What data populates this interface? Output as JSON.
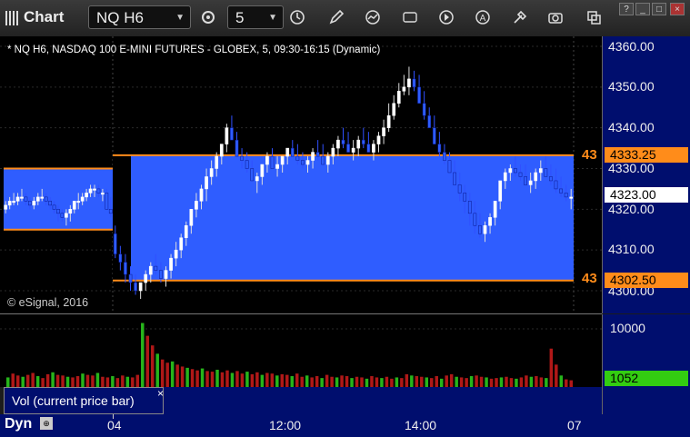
{
  "app": {
    "title": "Chart"
  },
  "toolbar": {
    "symbol": "NQ H6",
    "interval": "5",
    "icons": [
      "refresh-icon",
      "clock-icon",
      "pencil-icon",
      "studies-icon",
      "quote-icon",
      "play-icon",
      "a-icon",
      "tools-icon",
      "camera-icon",
      "copy-icon"
    ],
    "quote_icon_text": "QUOTE"
  },
  "chart": {
    "description": "* NQ H6, NASDAQ 100 E-MINI FUTURES - GLOBEX, 5, 09:30-16:15 (Dynamic)",
    "copyright": "© eSignal, 2016",
    "price_labels": [
      "4360.00",
      "4350.00",
      "4340.00",
      "4330.00",
      "4320.00",
      "4310.00",
      "4300.00"
    ],
    "upper_level_tag": "4333.25",
    "lower_level_tag": "4302.50",
    "current_price_tag": "4323.00",
    "upper_level_partial": "43",
    "lower_level_partial": "43",
    "colors": {
      "band": "#2f5dff",
      "level_line": "#ff8c1a",
      "axis_bg": "#000e6e",
      "up": "#ffffff",
      "down": "#2f5dff"
    }
  },
  "volume": {
    "label": "Vol (current price bar)",
    "close_label": "×",
    "axis_label": "10000",
    "current_value": "1052"
  },
  "time_axis": {
    "labels": [
      "04",
      "12:00",
      "14:00",
      "07"
    ]
  },
  "footer": {
    "mode": "Dyn"
  },
  "chart_data": {
    "type": "candlestick",
    "title": "",
    "ylim": [
      4298,
      4365
    ],
    "yticks": [
      4300,
      4310,
      4320,
      4330,
      4340,
      4350,
      4360
    ],
    "levels": [
      4333.25,
      4302.5
    ],
    "current_price": 4323.0,
    "series": [
      {
        "o": [
          4320,
          4321,
          4322,
          4322,
          4323,
          4323,
          4322,
          4321,
          4322,
          4323,
          4323,
          4322,
          4321,
          4320,
          4319,
          4318,
          4319,
          4320,
          4322,
          4322,
          4323,
          4324,
          4325,
          4325,
          4324,
          4324,
          4320
        ],
        "h": [
          4322,
          4323,
          4324,
          4324,
          4325,
          4324,
          4323,
          4323,
          4324,
          4325,
          4324,
          4323,
          4322,
          4321,
          4320,
          4320,
          4321,
          4322,
          4324,
          4324,
          4325,
          4326,
          4326,
          4326,
          4325,
          4325,
          4323
        ],
        "l": [
          4319,
          4320,
          4321,
          4321,
          4322,
          4321,
          4320,
          4320,
          4321,
          4322,
          4321,
          4320,
          4319,
          4317,
          4317,
          4316,
          4317,
          4319,
          4320,
          4321,
          4322,
          4323,
          4323,
          4323,
          4322,
          4320,
          4318
        ],
        "c": [
          4321,
          4322,
          4322,
          4323,
          4323,
          4322,
          4321,
          4322,
          4323,
          4323,
          4322,
          4321,
          4320,
          4319,
          4318,
          4319,
          4320,
          4322,
          4322,
          4323,
          4324,
          4325,
          4325,
          4324,
          4324,
          4320,
          4319
        ]
      },
      {
        "o": [
          4314,
          4309,
          4307,
          4304,
          4302,
          4300,
          4302,
          4304,
          4306,
          4305,
          4303,
          4305,
          4308,
          4310,
          4313,
          4316,
          4320,
          4322,
          4325,
          4328,
          4330,
          4333,
          4336,
          4340,
          4337,
          4333,
          4332,
          4330,
          4327,
          4328,
          4331,
          4333,
          4330,
          4331,
          4333,
          4335,
          4333,
          4332,
          4331,
          4332,
          4334,
          4333,
          4331,
          4333,
          4335,
          4337,
          4336,
          4334,
          4335,
          4337,
          4336,
          4334,
          4336,
          4338,
          4340,
          4343,
          4346,
          4349,
          4350,
          4352,
          4350,
          4346,
          4343,
          4340,
          4336,
          4334,
          4332,
          4329,
          4326,
          4324,
          4322,
          4319,
          4316,
          4314,
          4316,
          4318,
          4322,
          4327,
          4329,
          4330,
          4329,
          4328,
          4326,
          4327,
          4329,
          4330,
          4328,
          4327,
          4325,
          4324,
          4323
        ],
        "h": [
          4316,
          4311,
          4309,
          4306,
          4304,
          4302,
          4305,
          4307,
          4309,
          4307,
          4306,
          4309,
          4312,
          4314,
          4317,
          4320,
          4324,
          4326,
          4330,
          4332,
          4334,
          4336,
          4341,
          4343,
          4339,
          4335,
          4334,
          4332,
          4329,
          4331,
          4334,
          4335,
          4333,
          4333,
          4335,
          4337,
          4336,
          4334,
          4333,
          4335,
          4337,
          4336,
          4334,
          4336,
          4338,
          4340,
          4339,
          4337,
          4338,
          4340,
          4339,
          4337,
          4339,
          4342,
          4346,
          4348,
          4351,
          4353,
          4355,
          4354,
          4353,
          4349,
          4345,
          4343,
          4339,
          4336,
          4334,
          4332,
          4329,
          4326,
          4324,
          4322,
          4319,
          4317,
          4319,
          4322,
          4327,
          4330,
          4331,
          4333,
          4331,
          4331,
          4329,
          4330,
          4332,
          4333,
          4331,
          4330,
          4328,
          4326,
          4325
        ],
        "l": [
          4308,
          4305,
          4302,
          4300,
          4299,
          4298,
          4300,
          4302,
          4304,
          4302,
          4301,
          4303,
          4306,
          4308,
          4311,
          4314,
          4318,
          4320,
          4322,
          4326,
          4328,
          4331,
          4334,
          4337,
          4333,
          4330,
          4329,
          4327,
          4324,
          4326,
          4329,
          4331,
          4328,
          4329,
          4331,
          4333,
          4331,
          4330,
          4329,
          4330,
          4332,
          4331,
          4329,
          4331,
          4333,
          4335,
          4334,
          4332,
          4333,
          4335,
          4334,
          4332,
          4334,
          4336,
          4339,
          4342,
          4345,
          4348,
          4348,
          4349,
          4346,
          4342,
          4340,
          4336,
          4333,
          4331,
          4329,
          4326,
          4322,
          4319,
          4316,
          4314,
          4313,
          4312,
          4314,
          4316,
          4320,
          4325,
          4327,
          4328,
          4327,
          4326,
          4324,
          4325,
          4327,
          4328,
          4326,
          4324,
          4323,
          4322,
          4320
        ],
        "c": [
          4309,
          4307,
          4304,
          4302,
          4300,
          4302,
          4304,
          4306,
          4305,
          4303,
          4305,
          4308,
          4310,
          4313,
          4316,
          4320,
          4322,
          4325,
          4328,
          4330,
          4333,
          4336,
          4340,
          4337,
          4333,
          4332,
          4330,
          4327,
          4328,
          4331,
          4333,
          4330,
          4331,
          4333,
          4335,
          4333,
          4332,
          4331,
          4332,
          4334,
          4333,
          4331,
          4333,
          4335,
          4337,
          4336,
          4334,
          4335,
          4337,
          4336,
          4334,
          4336,
          4338,
          4340,
          4343,
          4346,
          4349,
          4350,
          4352,
          4350,
          4346,
          4343,
          4340,
          4336,
          4334,
          4332,
          4329,
          4326,
          4324,
          4322,
          4319,
          4316,
          4314,
          4316,
          4318,
          4322,
          4327,
          4329,
          4330,
          4329,
          4328,
          4326,
          4327,
          4329,
          4330,
          4328,
          4327,
          4325,
          4324,
          4323,
          4323
        ]
      }
    ],
    "volume": [
      1500,
      2100,
      1800,
      1600,
      1900,
      2200,
      1700,
      1400,
      2000,
      2300,
      1900,
      1800,
      1600,
      1500,
      1700,
      2100,
      1900,
      1800,
      2200,
      1600,
      1500,
      1700,
      1400,
      1800,
      1600,
      1500,
      1900,
      10000,
      8000,
      6500,
      5200,
      4300,
      3800,
      4000,
      3500,
      3200,
      3000,
      2800,
      2600,
      2900,
      2500,
      2400,
      2700,
      2300,
      2600,
      2200,
      2500,
      2100,
      2400,
      2000,
      2300,
      1900,
      2200,
      2100,
      1800,
      2000,
      1900,
      1700,
      2100,
      1600,
      1800,
      1500,
      1700,
      1400,
      1900,
      1600,
      1500,
      1800,
      1700,
      1400,
      1600,
      1500,
      1300,
      1700,
      1500,
      1400,
      1600,
      1300,
      1500,
      1400,
      2000,
      1800,
      1700,
      1600,
      1500,
      1400,
      1700,
      1300,
      1800,
      2000,
      1600,
      1500,
      1400,
      1700,
      1800,
      1600,
      1500,
      1300,
      1400,
      1500,
      1600,
      1400,
      1300,
      1500,
      1800,
      1600,
      1700,
      1500,
      1400,
      6000,
      3500,
      1800,
      1200,
      1052
    ],
    "volume_ylim": [
      0,
      10500
    ]
  }
}
